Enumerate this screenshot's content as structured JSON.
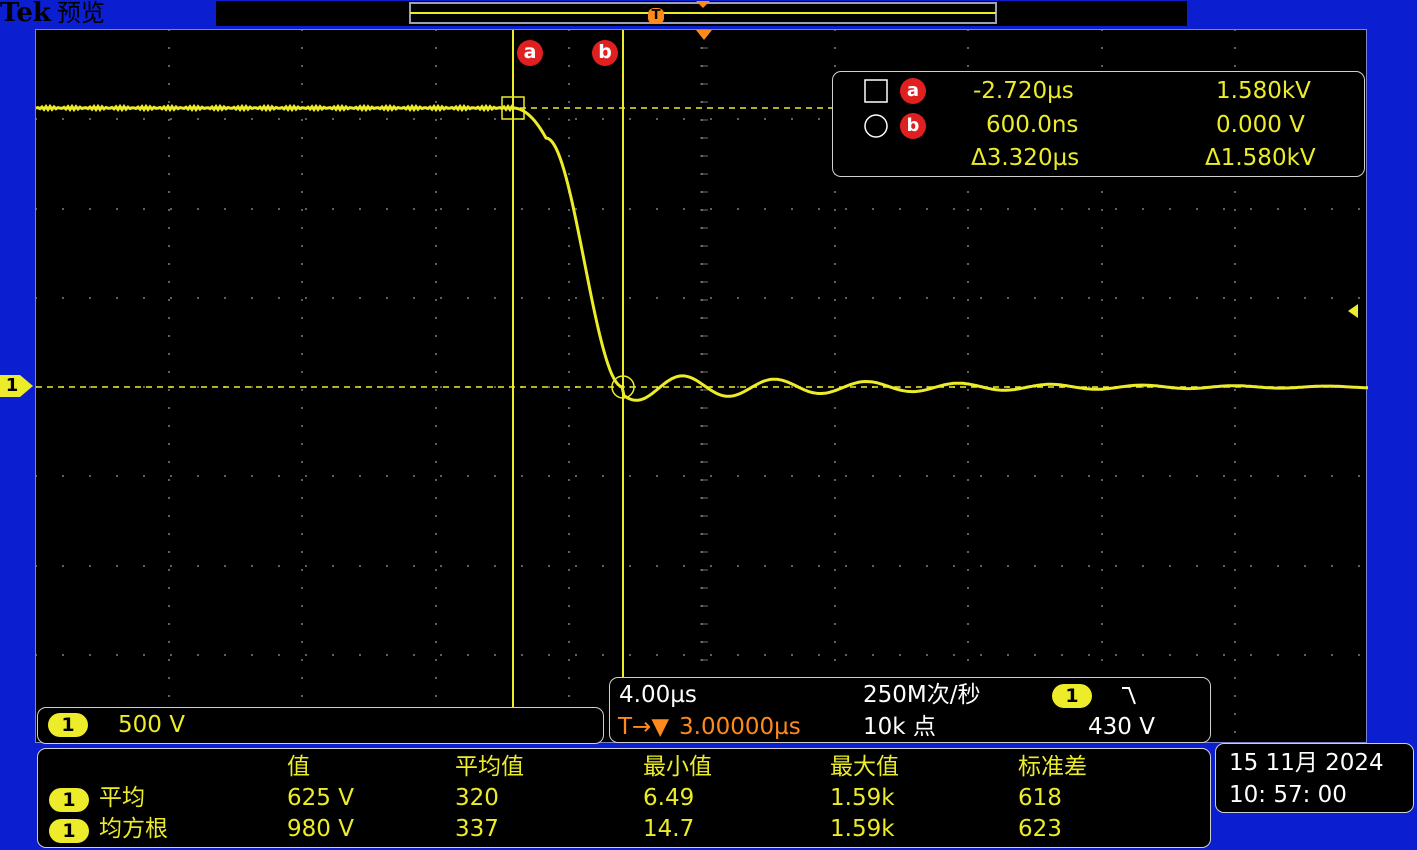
{
  "brand": {
    "logo": "Tek",
    "mode": "预览"
  },
  "trigger_marker_label": "T",
  "cursor_labels": {
    "a": "a",
    "b": "b"
  },
  "channel_marker": "1",
  "cursor_readout": {
    "row_a": {
      "time": "-2.720µs",
      "value": "1.580kV"
    },
    "row_b": {
      "time": "600.0ns",
      "value": "0.000 V"
    },
    "row_delta": {
      "time": "Δ3.320µs",
      "value": "Δ1.580kV"
    }
  },
  "channel_scale": {
    "channel": "1",
    "value": "500 V"
  },
  "timebase": {
    "time_per_div": "4.00µs",
    "sample_rate": "250M次/秒",
    "trigger_channel": "1",
    "trigger_slope_icon": "falling-edge-icon",
    "trigger_position_prefix": "T→▼",
    "trigger_position": "3.00000µs",
    "record_length": "10k 点",
    "trigger_level": "430 V"
  },
  "measurements": {
    "headers": [
      "值",
      "平均值",
      "最小值",
      "最大值",
      "标准差"
    ],
    "rows": [
      {
        "channel": "1",
        "name": "平均",
        "values": [
          "625 V",
          "320",
          "6.49",
          "1.59k",
          "618"
        ]
      },
      {
        "channel": "1",
        "name": "均方根",
        "values": [
          "980 V",
          "337",
          "14.7",
          "1.59k",
          "623"
        ]
      }
    ]
  },
  "datetime": {
    "date": "15 11月  2024",
    "time": "10: 57: 00"
  },
  "colors": {
    "trace": "#ecec2a",
    "background": "#0b1fd0",
    "cursor_badge": "#e02020",
    "trigger": "#ff8a1c"
  }
}
